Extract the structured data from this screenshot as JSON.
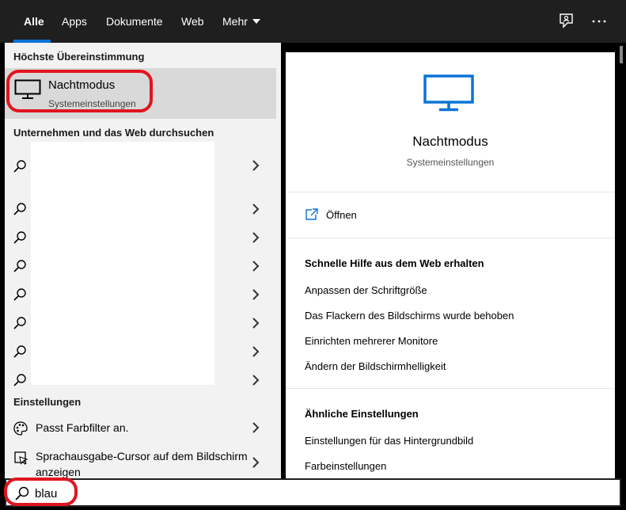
{
  "tabs": [
    {
      "label": "Alle"
    },
    {
      "label": "Apps"
    },
    {
      "label": "Dokumente"
    },
    {
      "label": "Web"
    },
    {
      "label": "Mehr"
    }
  ],
  "icons": {
    "feedback": "feedback-icon",
    "more": "more-options-icon"
  },
  "left": {
    "best_match_header": "Höchste Übereinstimmung",
    "best_match": {
      "title": "Nachtmodus",
      "subtitle": "Systemeinstellungen"
    },
    "web_header": "Unternehmen und das Web durchsuchen",
    "settings_header": "Einstellungen",
    "settings": [
      {
        "label": "Passt Farbfilter an."
      },
      {
        "label": "Sprachausgabe-Cursor auf dem Bildschirm anzeigen"
      }
    ]
  },
  "right": {
    "title": "Nachtmodus",
    "subtitle": "Systemeinstellungen",
    "open_label": "Öffnen",
    "help_header": "Schnelle Hilfe aus dem Web erhalten",
    "help_links": [
      "Anpassen der Schriftgröße",
      "Das Flackern des Bildschirms wurde behoben",
      "Einrichten mehrerer Monitore",
      "Ändern der Bildschirmhelligkeit"
    ],
    "related_header": "Ähnliche Einstellungen",
    "related_links": [
      "Einstellungen für das Hintergrundbild",
      "Farbeinstellungen"
    ]
  },
  "search": {
    "value": "blau"
  },
  "colors": {
    "accent": "#0a74d6",
    "highlight": "#e0151f"
  }
}
